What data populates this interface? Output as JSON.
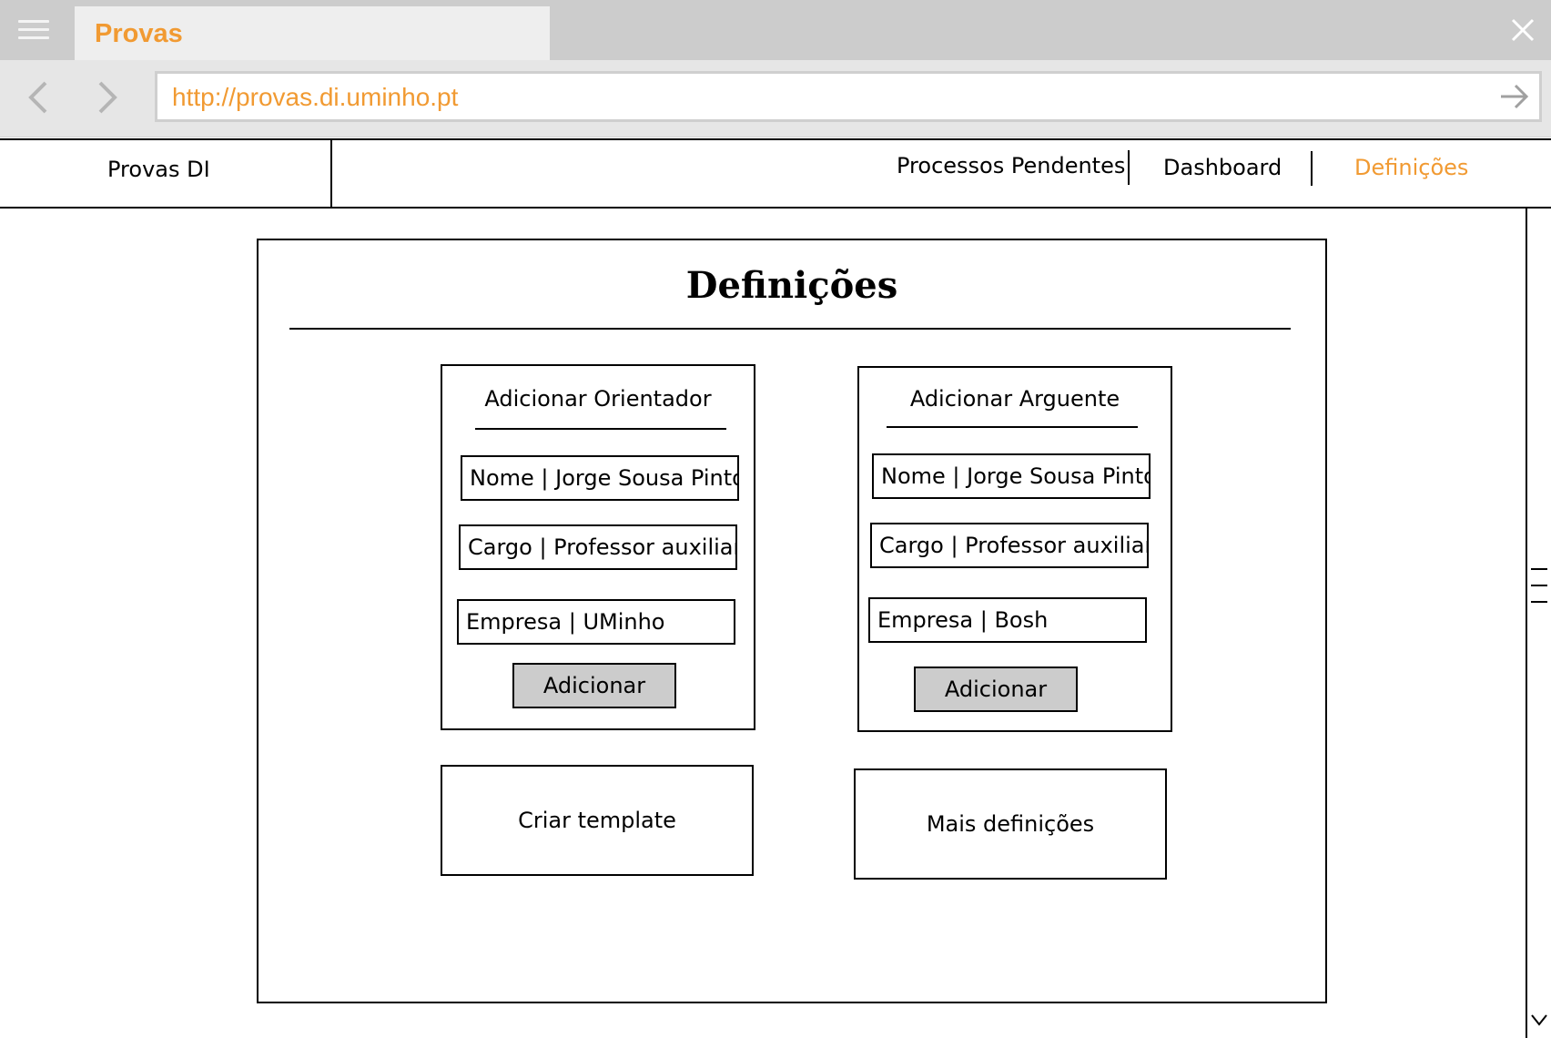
{
  "browser": {
    "tab_title": "Provas",
    "url": "http://provas.di.uminho.pt",
    "accent_color": "#f19a32"
  },
  "nav": {
    "brand": "Provas DI",
    "items": [
      {
        "label": "Processos Pendentes",
        "active": false
      },
      {
        "label": "Dashboard",
        "active": false
      },
      {
        "label": "Definições",
        "active": true
      }
    ]
  },
  "page": {
    "title": "Definições",
    "orientador": {
      "title": "Adicionar Orientador",
      "fields": [
        "Nome | Jorge Sousa Pinto",
        "Cargo | Professor auxiliar",
        "Empresa | UMinho"
      ],
      "button": "Adicionar"
    },
    "arguente": {
      "title": "Adicionar Arguente",
      "fields": [
        "Nome | Jorge Sousa Pinto",
        "Cargo | Professor auxiliar",
        "Empresa | Bosh"
      ],
      "button": "Adicionar"
    },
    "template_button": "Criar template",
    "more_button": "Mais definições"
  },
  "icons": [
    "menu-icon",
    "close-icon",
    "back-arrow-icon",
    "forward-arrow-icon",
    "go-arrow-icon",
    "scroll-down-icon"
  ]
}
